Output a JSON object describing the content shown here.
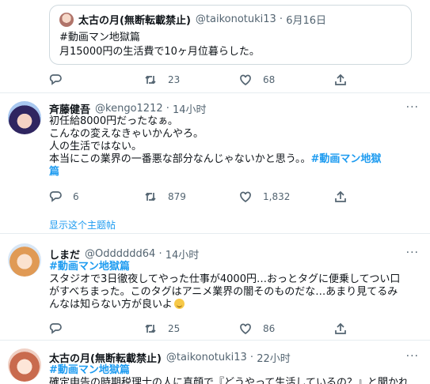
{
  "quoted": {
    "name": "太古の月(無断転載禁止)",
    "handle": "@taikonotuki13",
    "date": "6月16日",
    "tag": "#動画マン地獄篇",
    "text": "月15000円の生活費で10ヶ月位暮らした。",
    "retweets": "23",
    "likes": "68"
  },
  "tweets": [
    {
      "name": "斉藤健吾",
      "handle": "@kengo1212",
      "time": "14小时",
      "lines": [
        "初任給8000円だったなぁ。",
        "こんなの変えなきゃいかんやろ。",
        "人の生活ではない。"
      ],
      "line4": "本当にこの業界の一番悪な部分なんじゃないかと思う。。",
      "tag_a": "#動画マン地獄",
      "tag_b": "篇",
      "replies": "6",
      "retweets": "879",
      "likes": "1,832",
      "thread_link": "显示这个主题帖"
    },
    {
      "name": "しまだ",
      "handle": "@Odddddd64",
      "time": "14小时",
      "tag": "#動画マン地獄篇",
      "line1": "スタジオで3日徹夜してやった仕事が4000円…おっとタグに便乗してつい口",
      "line2": "がすべちまった。このタグはアニメ業界の闇そのものだな…あまり見てるみ",
      "line3": "んなは知らない方が良いよ",
      "retweets": "25",
      "likes": "86"
    },
    {
      "name": "太古の月(無断転載禁止)",
      "handle": "@taikonotuki13",
      "time": "22小时",
      "tag": "#動画マン地獄篇",
      "partial": "確定申告の時期税理士の人に真顔で『どうやって生活しているの？』と聞かれ"
    }
  ],
  "icons": {
    "reply": "reply-icon",
    "retweet": "retweet-icon",
    "like": "heart-icon",
    "share": "share-icon",
    "more": "more-icon"
  },
  "colors": {
    "accent": "#1d9bf0",
    "muted": "#536471"
  }
}
